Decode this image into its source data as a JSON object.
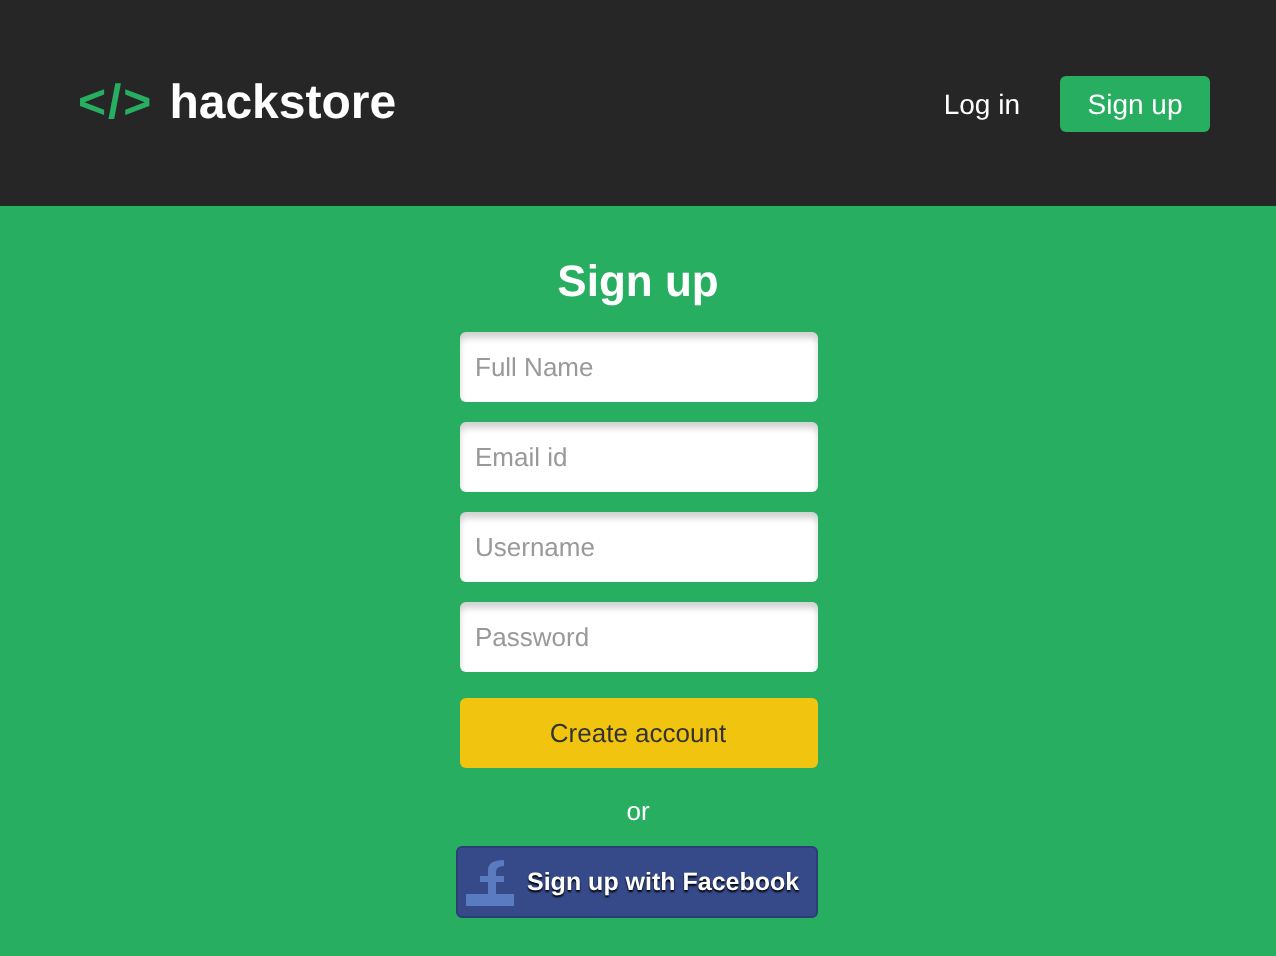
{
  "header": {
    "logo_mark": "</>",
    "logo_text": "hackstore",
    "nav": [
      {
        "kind": "link",
        "label": "Log in"
      },
      {
        "kind": "button",
        "label": "Sign up"
      }
    ]
  },
  "form": {
    "title": "Sign up",
    "fields": [
      {
        "placeholder": "Full Name"
      },
      {
        "placeholder": "Email id"
      },
      {
        "placeholder": "Username"
      },
      {
        "placeholder": "Password"
      }
    ],
    "submit": "Create account",
    "separator": "or",
    "social_button": "Sign up with Facebook"
  }
}
